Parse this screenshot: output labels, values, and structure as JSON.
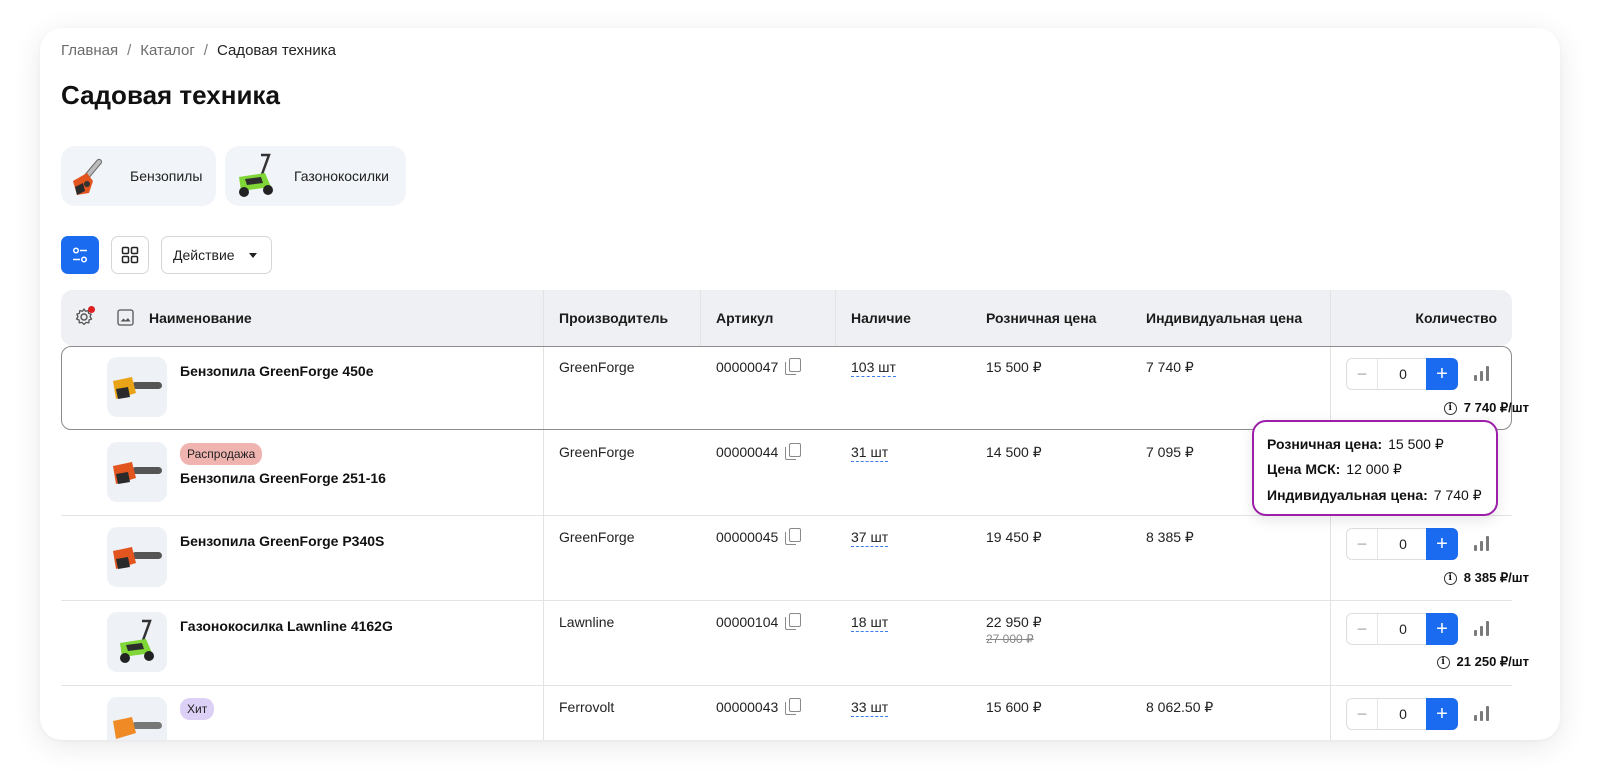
{
  "breadcrumb": {
    "home": "Главная",
    "catalog": "Каталог",
    "current": "Садовая техника"
  },
  "page_title": "Садовая техника",
  "categories": [
    {
      "label": "Бензопилы",
      "icon": "chainsaw-icon"
    },
    {
      "label": "Газонокосилки",
      "icon": "lawnmower-icon"
    }
  ],
  "toolbar": {
    "action_label": "Действие"
  },
  "table": {
    "headers": {
      "name": "Наименование",
      "manufacturer": "Производитель",
      "sku": "Артикул",
      "stock": "Наличие",
      "retail_price": "Розничная цена",
      "individual_price": "Индивидуальная цена",
      "quantity": "Количество"
    },
    "rows": [
      {
        "badge": "",
        "name": "Бензопила GreenForge 450e",
        "manufacturer": "GreenForge",
        "sku": "00000047",
        "stock": "103 шт",
        "retail_price": "15 500 ₽",
        "old_price": "",
        "individual_price": "7 740 ₽",
        "qty": "0",
        "per_unit": "7 740 ₽/шт"
      },
      {
        "badge": "Распродажа",
        "name": "Бензопила GreenForge 251-16",
        "manufacturer": "GreenForge",
        "sku": "00000044",
        "stock": "31 шт",
        "retail_price": "14 500 ₽",
        "old_price": "",
        "individual_price": "7 095 ₽",
        "qty": "0",
        "per_unit": ""
      },
      {
        "badge": "",
        "name": "Бензопила GreenForge P340S",
        "manufacturer": "GreenForge",
        "sku": "00000045",
        "stock": "37 шт",
        "retail_price": "19 450 ₽",
        "old_price": "",
        "individual_price": "8 385 ₽",
        "qty": "0",
        "per_unit": "8 385 ₽/шт"
      },
      {
        "badge": "",
        "name": "Газонокосилка Lawnline 4162G",
        "manufacturer": "Lawnline",
        "sku": "00000104",
        "stock": "18 шт",
        "retail_price": "22 950 ₽",
        "old_price": "27 000 ₽",
        "individual_price": "",
        "qty": "0",
        "per_unit": "21 250 ₽/шт"
      },
      {
        "badge": "Хит",
        "name": "",
        "manufacturer": "Ferrovolt",
        "sku": "00000043",
        "stock": "33 шт",
        "retail_price": "15 600 ₽",
        "old_price": "",
        "individual_price": "8 062.50 ₽",
        "qty": "0",
        "per_unit": ""
      }
    ]
  },
  "tooltip": {
    "retail_label": "Розничная цена:",
    "retail_value": "15 500 ₽",
    "msk_label": "Цена МСК:",
    "msk_value": "12 000 ₽",
    "individual_label": "Индивидуальная цена:",
    "individual_value": "7 740 ₽"
  },
  "colors": {
    "accent": "#1a6bf0",
    "sale_badge": "#f0b4b0",
    "hit_badge": "#ddd0f6",
    "tooltip_border": "#9b1fa8",
    "notification_dot": "#e02020"
  }
}
